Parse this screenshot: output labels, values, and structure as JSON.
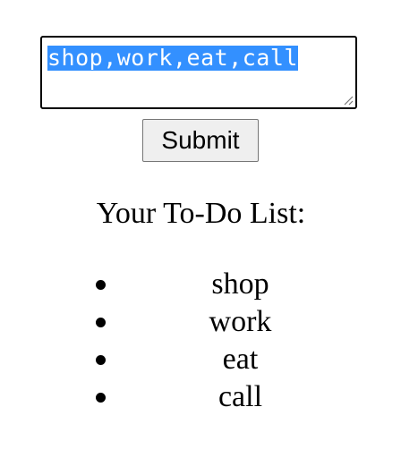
{
  "form": {
    "textarea_value": "shop,work,eat,call",
    "submit_label": "Submit"
  },
  "todo": {
    "title": "Your To-Do List:",
    "items": [
      "shop",
      "work",
      "eat",
      "call"
    ]
  },
  "colors": {
    "selection_highlight": "#3390ff",
    "button_background": "#efefef"
  }
}
